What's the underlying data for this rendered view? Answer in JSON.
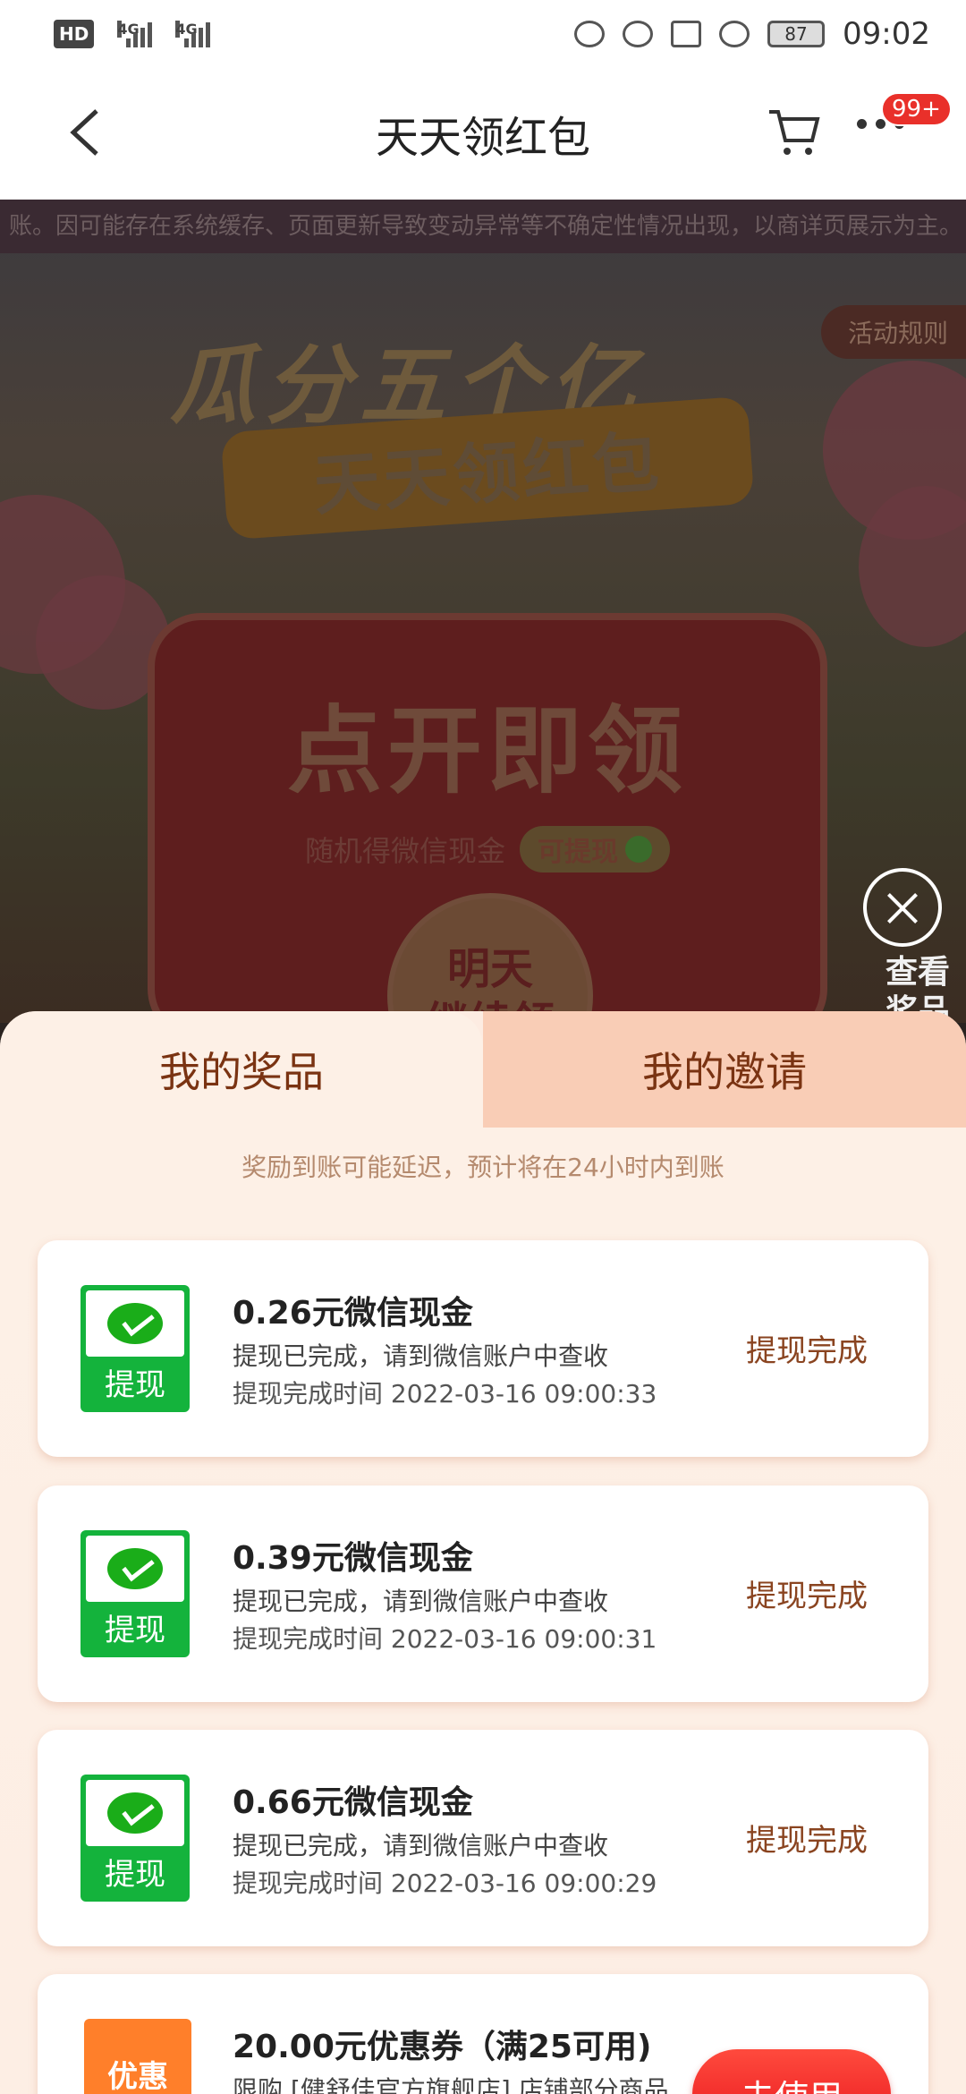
{
  "status_bar": {
    "left_hd": "HD",
    "net1": "4G",
    "net2": "4G",
    "battery": "87",
    "time": "09:02"
  },
  "nav": {
    "title": "天天领红包",
    "badge": "99+"
  },
  "banner": {
    "notice": "账。因可能存在系统缓存、页面更新导致变动异常等不确定性情况出现，以商详页展示为主。",
    "rules": "活动规则",
    "title_art": "瓜分五个亿",
    "ribbon": "天天领红包",
    "redpack_big": "点开即领",
    "redpack_sub": "随机得微信现金",
    "redpack_pill": "可提现",
    "coin_line1": "明天",
    "coin_line2": "继续领",
    "view_prizes": "查看奖品"
  },
  "sheet": {
    "tab_prizes": "我的奖品",
    "tab_invites": "我的邀请",
    "delay_note": "奖励到账可能延迟，预计将在24小时内到账",
    "cards": [
      {
        "icon_label": "提现",
        "title": "0.26元微信现金",
        "desc": "提现已完成，请到微信账户中查收",
        "time": "提现完成时间 2022-03-16 09:00:33",
        "status": "提现完成"
      },
      {
        "icon_label": "提现",
        "title": "0.39元微信现金",
        "desc": "提现已完成，请到微信账户中查收",
        "time": "提现完成时间 2022-03-16 09:00:31",
        "status": "提现完成"
      },
      {
        "icon_label": "提现",
        "title": "0.66元微信现金",
        "desc": "提现已完成，请到微信账户中查收",
        "time": "提现完成时间 2022-03-16 09:00:29",
        "status": "提现完成"
      }
    ],
    "coupon": {
      "icon_label": "优惠",
      "title": "20.00元优惠券（满25可用)",
      "desc": "限购 [健舒佳官方旗舰店] 店铺部分商品",
      "button": "去使用"
    }
  }
}
